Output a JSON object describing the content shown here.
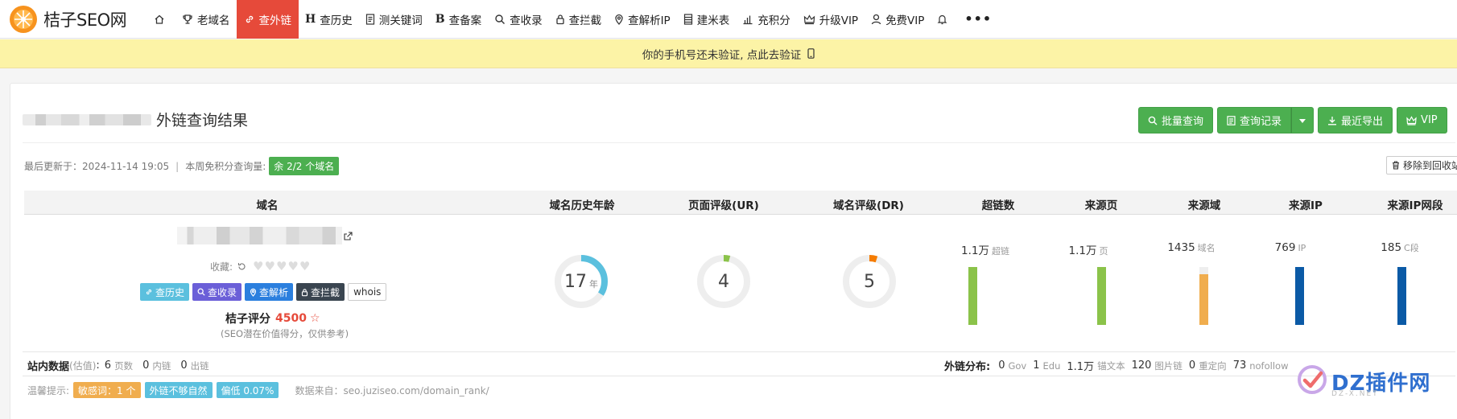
{
  "brand": {
    "name": "桔子SEO网"
  },
  "nav": {
    "items": [
      {
        "label": "",
        "icon": "home-icon"
      },
      {
        "label": "老域名",
        "icon": "trophy-icon"
      },
      {
        "label": "查外链",
        "icon": "link-icon",
        "active": true
      },
      {
        "label": "查历史",
        "icon": "h-letter-icon"
      },
      {
        "label": "测关键词",
        "icon": "document-icon"
      },
      {
        "label": "查备案",
        "icon": "b-letter-icon"
      },
      {
        "label": "查收录",
        "icon": "search-icon"
      },
      {
        "label": "查拦截",
        "icon": "lock-icon"
      },
      {
        "label": "查解析IP",
        "icon": "map-pin-icon"
      },
      {
        "label": "建米表",
        "icon": "table-icon"
      },
      {
        "label": "充积分",
        "icon": "bar-chart-icon"
      },
      {
        "label": "升级VIP",
        "icon": "crown-icon"
      },
      {
        "label": "免费VIP",
        "icon": "user-icon"
      }
    ],
    "more": "•••"
  },
  "banner": {
    "text": "你的手机号还未验证, 点此去验证"
  },
  "page": {
    "title": "外链查询结果"
  },
  "actions": {
    "batch": "批量查询",
    "history": "查询记录",
    "export": "最近导出",
    "vip": "VIP"
  },
  "meta": {
    "updated_label": "最后更新于：",
    "updated_value": "2024-11-14 19:05",
    "weekly_label": "本周免积分查询量:",
    "quota_pill": "余 2/2 个域名",
    "recycle": "移除到回收站"
  },
  "table": {
    "headers": [
      "域名",
      "域名历史年龄",
      "页面评级(UR)",
      "域名评级(DR)",
      "超链数",
      "来源页",
      "来源域",
      "来源IP",
      "来源IP网段"
    ]
  },
  "domain": {
    "collect_label": "收藏:",
    "tags": [
      "查历史",
      "查收录",
      "查解析",
      "查拦截",
      "whois"
    ],
    "score_label": "桔子评分",
    "score_value": "4500",
    "score_note": "(SEO潜在价值得分，仅供参考)"
  },
  "rings": {
    "age": {
      "value": "17",
      "unit": "年",
      "fraction": 0.34,
      "color": "#5bc0de"
    },
    "ur": {
      "value": "4",
      "fraction": 0.04,
      "color": "#8bc34a"
    },
    "dr": {
      "value": "5",
      "fraction": 0.05,
      "color": "#f57c00"
    }
  },
  "metrics": [
    {
      "value": "1.1万",
      "unit": "超链",
      "color": "#8bc34a",
      "fill": 1.0
    },
    {
      "value": "1.1万",
      "unit": "页",
      "color": "#8bc34a",
      "fill": 1.0
    },
    {
      "value": "1435",
      "unit": "域名",
      "color": "#f0ad4e",
      "fill": 0.88
    },
    {
      "value": "769",
      "unit": "IP",
      "color": "#0b5aa6",
      "fill": 1.0
    },
    {
      "value": "185",
      "unit": "C段",
      "color": "#0b5aa6",
      "fill": 1.0
    }
  ],
  "site_stats": {
    "label": "站内数据",
    "hint": "(估值)",
    "pages_value": "6",
    "pages_label": "页数",
    "inner_value": "0",
    "inner_label": "内链",
    "out_value": "0",
    "out_label": "出链"
  },
  "out_dist": {
    "label": "外链分布:",
    "items": [
      {
        "value": "0",
        "label": "Gov"
      },
      {
        "value": "1",
        "label": "Edu"
      },
      {
        "value": "1.1万",
        "label": "锚文本"
      },
      {
        "value": "120",
        "label": "图片链"
      },
      {
        "value": "0",
        "label": "重定向"
      },
      {
        "value": "73",
        "label": "nofollow"
      }
    ]
  },
  "tips": {
    "label": "温馨提示:",
    "items": [
      {
        "text": "敏感词：1 个",
        "color": "#f0ad4e"
      },
      {
        "text": "外链不够自然",
        "color": "#5bc0de"
      },
      {
        "text": "偏低 0.07%",
        "color": "#5bc0de"
      }
    ],
    "source": "数据来自：seo.juziseo.com/domain_rank/"
  },
  "watermark": {
    "text": "DZ插件网",
    "sub": "DZ-X.NET"
  }
}
